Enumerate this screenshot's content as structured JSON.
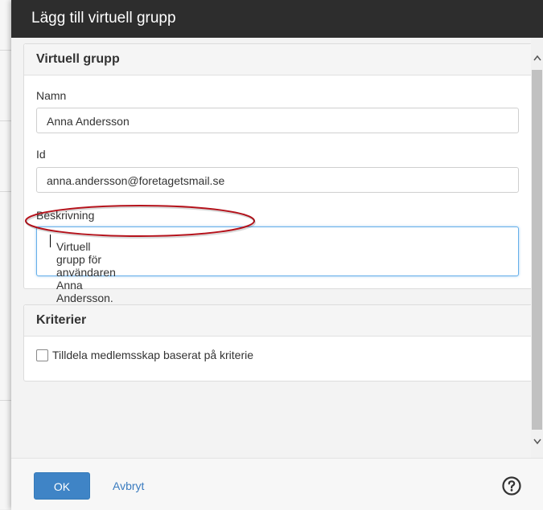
{
  "dialog": {
    "title": "Lägg till virtuell grupp"
  },
  "virtual_group": {
    "heading": "Virtuell grupp",
    "name_label": "Namn",
    "name_value": "Anna Andersson",
    "id_label": "Id",
    "id_value": "anna.andersson@foretagetsmail.se",
    "description_label": "Beskrivning",
    "description_value": "Virtuell grupp för användaren Anna Andersson."
  },
  "criteria": {
    "heading": "Kriterier",
    "checkbox_label": "Tilldela medlemsskap baserat på kriterie",
    "checked": false
  },
  "footer": {
    "ok_label": "OK",
    "cancel_label": "Avbryt"
  },
  "colors": {
    "titlebar": "#2d2d2d",
    "primary_button": "#3f84c6",
    "link": "#3a7bbf",
    "annotation": "#b5121b"
  },
  "icons": {
    "help": "question-circle-icon",
    "scroll_up": "chevron-up-icon",
    "scroll_down": "chevron-down-icon"
  }
}
